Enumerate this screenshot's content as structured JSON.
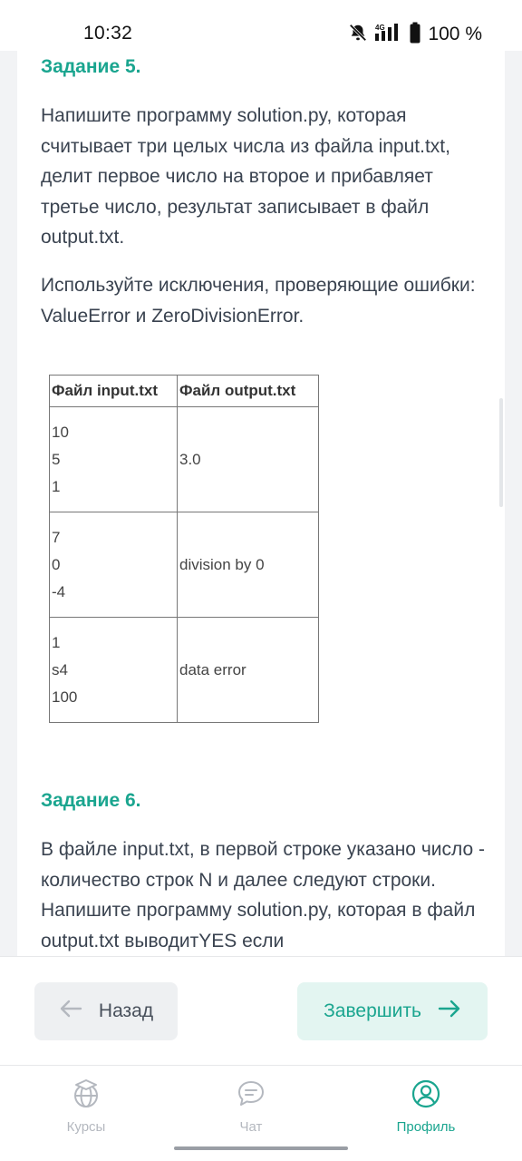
{
  "status_bar": {
    "time": "10:32",
    "network": "4G",
    "battery": "100 %",
    "icons": [
      "bell-off-icon",
      "signal-icon",
      "battery-icon"
    ]
  },
  "task5": {
    "title": "Задание 5.",
    "paragraph1": "Напишите программу solution.py, которая считывает три целых числа из файла input.txt, делит первое число на второе и прибавляет третье число, результат записывает в  файл output.txt.",
    "paragraph2": "Используйте исключения, проверяющие ошибки: ValueError и ZeroDivisionError.",
    "table": {
      "headers": [
        "Файл input.txt",
        "Файл output.txt"
      ],
      "rows": [
        {
          "input": [
            "10",
            "5",
            "1"
          ],
          "output": "3.0"
        },
        {
          "input": [
            "7",
            "0",
            "-4"
          ],
          "output": "division by 0"
        },
        {
          "input": [
            "1",
            "s4",
            "100"
          ],
          "output": "data error"
        }
      ]
    }
  },
  "task6": {
    "title": "Задание 6.",
    "paragraph": "В файле input.txt, в первой строке указано число - количество строк N и далее следуют строки. Напишите программу solution.py, которая в файл output.txt выводитYES если"
  },
  "actions": {
    "back_label": "Назад",
    "finish_label": "Завершить"
  },
  "tabs": [
    {
      "label": "Курсы",
      "icon": "courses-globe-icon",
      "active": false
    },
    {
      "label": "Чат",
      "icon": "chat-icon",
      "active": false
    },
    {
      "label": "Профиль",
      "icon": "profile-icon",
      "active": true
    }
  ],
  "colors": {
    "accent": "#1aa58f",
    "text": "#3a4350",
    "muted": "#b4b8bf"
  }
}
